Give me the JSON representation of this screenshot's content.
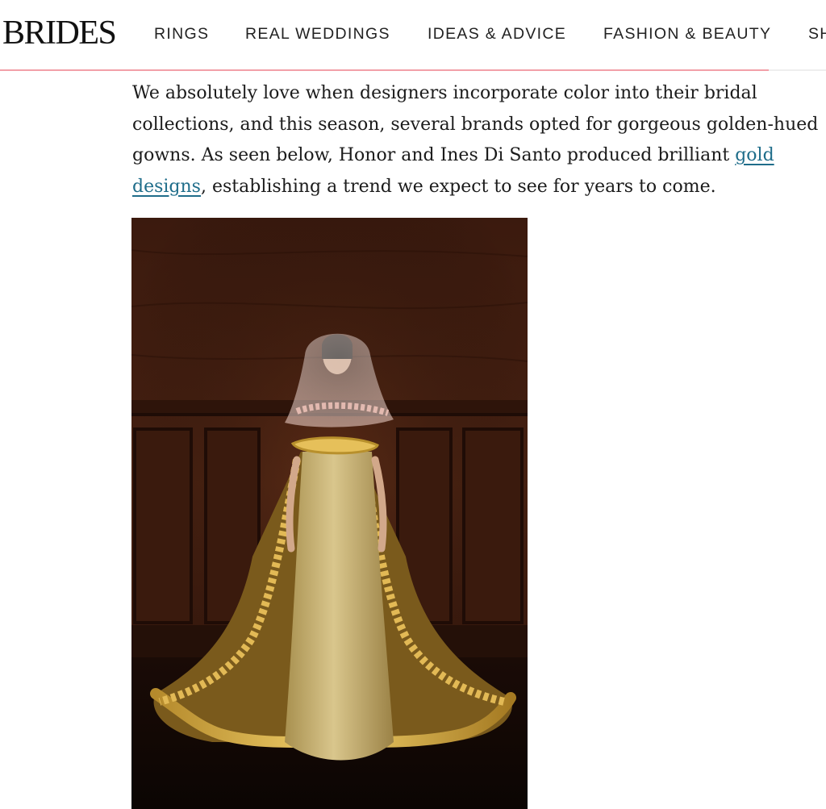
{
  "site": {
    "logo": "BRIDES",
    "brand_accent_color": "#f2a0a8"
  },
  "nav": {
    "items": [
      {
        "label": "RINGS"
      },
      {
        "label": "REAL WEDDINGS"
      },
      {
        "label": "IDEAS & ADVICE"
      },
      {
        "label": "FASHION & BEAUTY"
      },
      {
        "label": "SH"
      }
    ]
  },
  "article": {
    "line1": "We absolutely love when designers incorporate color into their bridal",
    "line2": "collections, and this season, several brands opted for gorgeous golden-hued",
    "line3_before_link": "gowns. As seen below, Honor and Ines Di Santo produced brilliant ",
    "link_part1": "gold",
    "link_part2": "designs",
    "line4_after_link": ", establishing a trend we expect to see for years to come.",
    "link_color": "#1f6d8a"
  },
  "photo": {
    "icon": "photo-of-gold-ruffled-bridal-gown"
  }
}
